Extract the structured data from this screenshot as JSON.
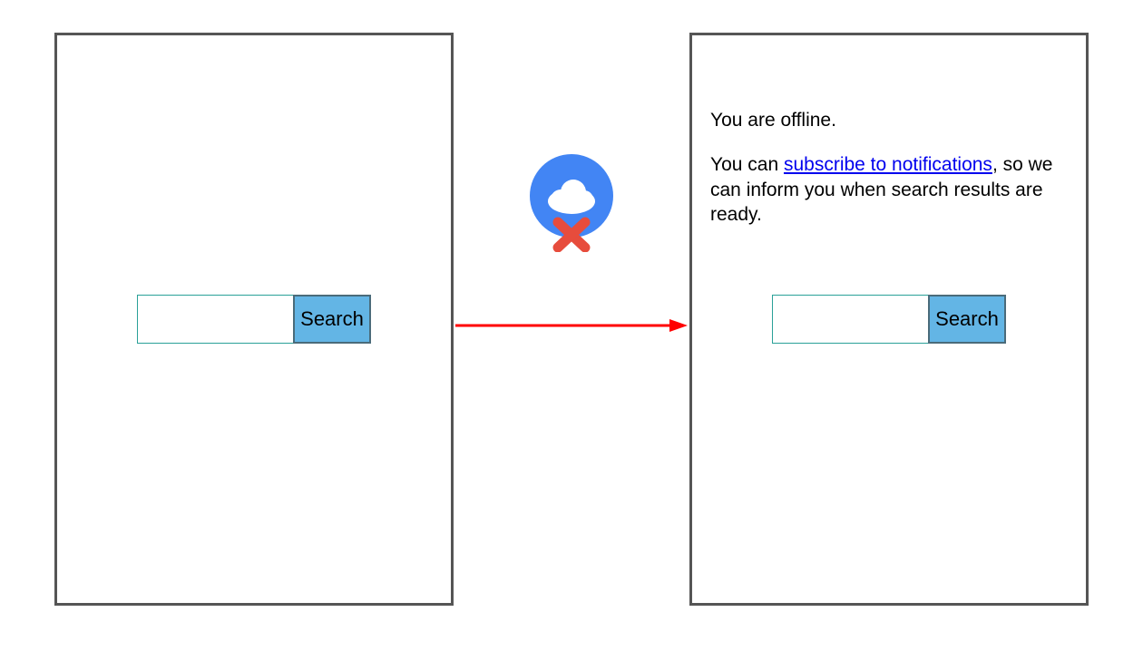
{
  "left_panel": {
    "search": {
      "value": "",
      "button_label": "Search"
    }
  },
  "right_panel": {
    "offline": {
      "line1": "You are offline.",
      "line2_prefix": "You can ",
      "line2_link": "subscribe to notifications",
      "line2_suffix": ", so we can inform you when search results are ready."
    },
    "search": {
      "value": "",
      "button_label": "Search"
    }
  },
  "icons": {
    "cloud_offline": "cloud-offline-icon",
    "arrow": "arrow-right-icon"
  },
  "colors": {
    "panel_border": "#555555",
    "input_border": "#2aa198",
    "button_bg": "#63b5e5",
    "button_border": "#4a6b7a",
    "arrow": "#ff0000",
    "cloud_circle": "#4285f4",
    "cloud_fill": "#ffffff",
    "cross": "#e74c3c",
    "link": "#0000ee"
  }
}
